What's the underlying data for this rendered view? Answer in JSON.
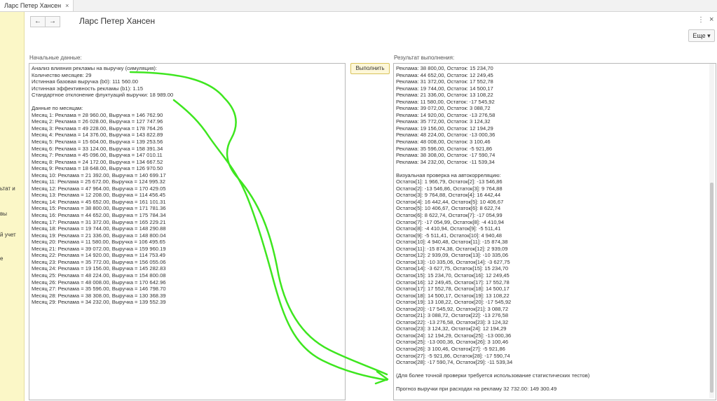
{
  "tab": {
    "title": "Ларс Петер Хансен",
    "close": "×"
  },
  "sidebar": {
    "items": [
      "ьтат и",
      "вы",
      "й учет",
      "е"
    ]
  },
  "header": {
    "back": "←",
    "forward": "→",
    "title": "Ларс Петер Хансен",
    "menu": "⋮",
    "close": "×",
    "more_label": "Еще ▾"
  },
  "left_panel": {
    "label": "Начальные данные:",
    "lines": [
      "Анализ влияния рекламы на выручку (симуляция):",
      "Количество месяцев: 29",
      "Истинная базовая выручка (b0): 111 560.00",
      "Истинная эффективность рекламы (b1): 1.15",
      "Стандартное отклонение флуктуаций выручки: 18 989.00",
      "",
      "Данные по месяцам:",
      "Месяц 1: Реклама = 28 960.00, Выручка = 146 762.90",
      "Месяц 2: Реклама = 26 028.00, Выручка = 127 747.96",
      "Месяц 3: Реклама = 49 228.00, Выручка = 178 764.26",
      "Месяц 4: Реклама = 14 376.00, Выручка = 143 822.89",
      "Месяц 5: Реклама = 15 604.00, Выручка = 139 253.56",
      "Месяц 6: Реклама = 33 124.00, Выручка = 158 391.34",
      "Месяц 7: Реклама = 45 096.00, Выручка = 147 010.11",
      "Месяц 8: Реклама = 24 172.00, Выручка = 134 667.52",
      "Месяц 9: Реклама = 18 648.00, Выручка = 126 970.50",
      "Месяц 10: Реклама = 21 392.00, Выручка = 140 699.17",
      "Месяц 11: Реклама = 25 672.00, Выручка = 124 995.32",
      "Месяц 12: Реклама = 47 964.00, Выручка = 170 429.05",
      "Месяц 13: Реклама = 12 208.00, Выручка = 114 456.45",
      "Месяц 14: Реклама = 45 652.00, Выручка = 161 101.31",
      "Месяц 15: Реклама = 38 800.00, Выручка = 171 781.36",
      "Месяц 16: Реклама = 44 652.00, Выручка = 175 784.34",
      "Месяц 17: Реклама = 31 372.00, Выручка = 165 229.21",
      "Месяц 18: Реклама = 19 744.00, Выручка = 148 290.88",
      "Месяц 19: Реклама = 21 336.00, Выручка = 148 800.04",
      "Месяц 20: Реклама = 11 580.00, Выручка = 106 495.65",
      "Месяц 21: Реклама = 39 072.00, Выручка = 159 960.19",
      "Месяц 22: Реклама = 14 920.00, Выручка = 114 753.49",
      "Месяц 23: Реклама = 35 772.00, Выручка = 156 055.06",
      "Месяц 24: Реклама = 19 156.00, Выручка = 145 282.83",
      "Месяц 25: Реклама = 48 224.00, Выручка = 154 800.08",
      "Месяц 26: Реклама = 48 008.00, Выручка = 170 642.96",
      "Месяц 27: Реклама = 35 596.00, Выручка = 146 798.70",
      "Месяц 28: Реклама = 38 308.00, Выручка = 130 368.39",
      "Месяц 29: Реклама = 34 232.00, Выручка = 139 552.39"
    ]
  },
  "run_button": "Выполнить",
  "right_panel": {
    "label": "Результат выполнения:",
    "lines": [
      "Реклама: 38 800,00, Остаток: 15 234,70",
      "Реклама: 44 652,00, Остаток: 12 249,45",
      "Реклама: 31 372,00, Остаток: 17 552,78",
      "Реклама: 19 744,00, Остаток: 14 500,17",
      "Реклама: 21 336,00, Остаток: 13 108,22",
      "Реклама: 11 580,00, Остаток: -17 545,92",
      "Реклама: 39 072,00, Остаток: 3 088,72",
      "Реклама: 14 920,00, Остаток: -13 276,58",
      "Реклама: 35 772,00, Остаток: 3 124,32",
      "Реклама: 19 156,00, Остаток: 12 194,29",
      "Реклама: 48 224,00, Остаток: -13 000,36",
      "Реклама: 48 008,00, Остаток: 3 100,46",
      "Реклама: 35 596,00, Остаток: -5 921,86",
      "Реклама: 38 308,00, Остаток: -17 590,74",
      "Реклама: 34 232,00, Остаток: -11 539,34",
      "",
      "Визуальная проверка на автокорреляцию:",
      "Остаток[1]: 1 966,79, Остаток[2]: -13 546,86",
      "Остаток[2]: -13 546,86, Остаток[3]: 9 764,88",
      "Остаток[3]: 9 764,88, Остаток[4]: 16 442,44",
      "Остаток[4]: 16 442,44, Остаток[5]: 10 406,67",
      "Остаток[5]: 10 406,67, Остаток[6]: 8 622,74",
      "Остаток[6]: 8 622,74, Остаток[7]: -17 054,99",
      "Остаток[7]: -17 054,99, Остаток[8]: -4 410,94",
      "Остаток[8]: -4 410,94, Остаток[9]: -5 511,41",
      "Остаток[9]: -5 511,41, Остаток[10]: 4 940,48",
      "Остаток[10]: 4 940,48, Остаток[11]: -15 874,38",
      "Остаток[11]: -15 874,38, Остаток[12]: 2 939,09",
      "Остаток[12]: 2 939,09, Остаток[13]: -10 335,06",
      "Остаток[13]: -10 335,06, Остаток[14]: -3 627,75",
      "Остаток[14]: -3 627,75, Остаток[15]: 15 234,70",
      "Остаток[15]: 15 234,70, Остаток[16]: 12 249,45",
      "Остаток[16]: 12 249,45, Остаток[17]: 17 552,78",
      "Остаток[17]: 17 552,78, Остаток[18]: 14 500,17",
      "Остаток[18]: 14 500,17, Остаток[19]: 13 108,22",
      "Остаток[19]: 13 108,22, Остаток[20]: -17 545,92",
      "Остаток[20]: -17 545,92, Остаток[21]: 3 088,72",
      "Остаток[21]: 3 088,72, Остаток[22]: -13 276,58",
      "Остаток[22]: -13 276,58, Остаток[23]: 3 124,32",
      "Остаток[23]: 3 124,32, Остаток[24]: 12 194,29",
      "Остаток[24]: 12 194,29, Остаток[25]: -13 000,36",
      "Остаток[25]: -13 000,36, Остаток[26]: 3 100,46",
      "Остаток[26]: 3 100,46, Остаток[27]: -5 921,86",
      "Остаток[27]: -5 921,86, Остаток[28]: -17 590,74",
      "Остаток[28]: -17 590,74, Остаток[29]: -11 539,34",
      "",
      "(Для более точной проверки требуется использование статистических тестов)",
      "",
      "Прогноз выручки при расходах на рекламу 32 732.00: 149 300.49",
      "",
      ". ."
    ]
  },
  "colors": {
    "sidebar": "#fbf7c7",
    "annotation": "#3ee61f",
    "run_button": "#fdf7d8"
  }
}
